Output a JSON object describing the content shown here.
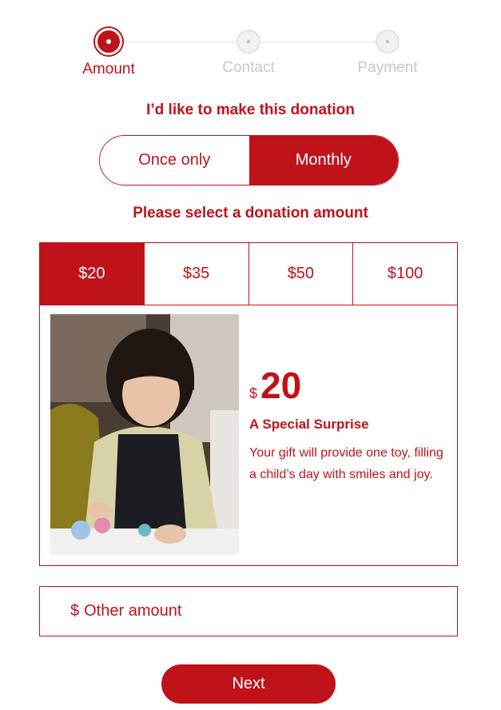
{
  "steps": [
    {
      "label": "Amount",
      "state": "active"
    },
    {
      "label": "Contact",
      "state": "inactive"
    },
    {
      "label": "Payment",
      "state": "inactive"
    }
  ],
  "frequency": {
    "heading": "I’d like to make this donation",
    "options": [
      "Once only",
      "Monthly"
    ],
    "selected": "Monthly"
  },
  "amount": {
    "heading": "Please select a donation amount",
    "options": [
      "$20",
      "$35",
      "$50",
      "$100"
    ],
    "selected": "$20"
  },
  "impact": {
    "currency": "$",
    "value": "20",
    "title": "A Special Surprise",
    "description": "Your gift will provide one toy, filling a child’s day with smiles and joy."
  },
  "other_amount": {
    "currency": "$",
    "placeholder": "Other amount"
  },
  "next_label": "Next",
  "colors": {
    "brand_red": "#c0121a",
    "inactive_gray": "#c8c8c8",
    "white": "#ffffff"
  }
}
